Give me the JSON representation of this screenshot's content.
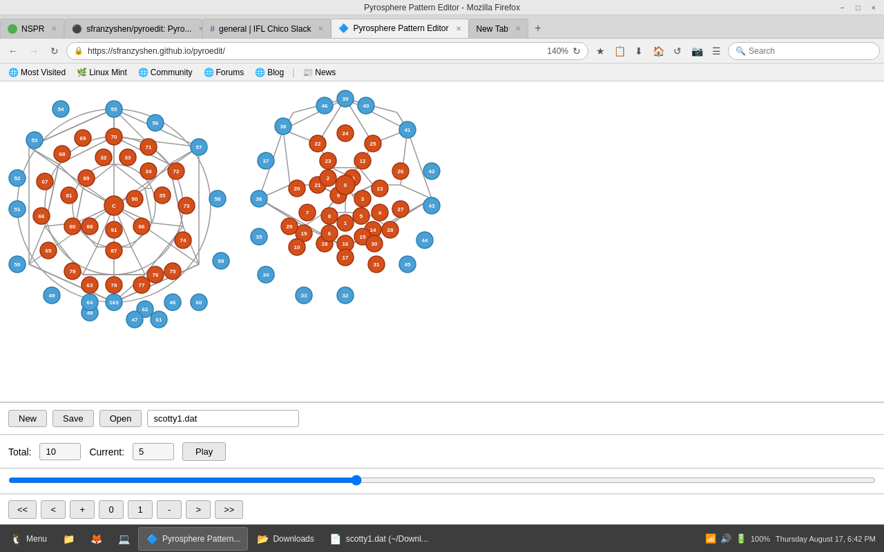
{
  "titlebar": {
    "title": "Pyrosphere Pattern Editor - Mozilla Firefox",
    "controls": [
      "−",
      "□",
      "×"
    ]
  },
  "tabs": [
    {
      "id": "nspr",
      "label": "NSPR",
      "icon_color": "#4CAF50",
      "active": false,
      "closable": true
    },
    {
      "id": "github",
      "label": "sfranzyshen/pyroedit: Pyro...",
      "icon_color": "#333",
      "active": false,
      "closable": true
    },
    {
      "id": "ifl",
      "label": "general | IFL Chico Slack",
      "icon_color": "#5a3e8a",
      "active": false,
      "closable": true
    },
    {
      "id": "pyrosphere",
      "label": "Pyrosphere Pattern Editor",
      "icon_color": "#e8612c",
      "active": true,
      "closable": true
    },
    {
      "id": "newtab",
      "label": "New Tab",
      "icon_color": "",
      "active": false,
      "closable": true
    }
  ],
  "navbar": {
    "back_disabled": false,
    "forward_disabled": true,
    "url": "https://sfranzyshen.github.io/pyroedit/",
    "zoom": "140%",
    "search_placeholder": "Search"
  },
  "bookmarks": [
    {
      "id": "most-visited",
      "label": "Most Visited",
      "icon": "🌐"
    },
    {
      "id": "linux-mint",
      "label": "Linux Mint",
      "icon": "🌿"
    },
    {
      "id": "community",
      "label": "Community",
      "icon": "🌐"
    },
    {
      "id": "forums",
      "label": "Forums",
      "icon": "🌐"
    },
    {
      "id": "blog",
      "label": "Blog",
      "icon": "🌐"
    },
    {
      "id": "news",
      "label": "News",
      "icon": "📰"
    }
  ],
  "toolbar": {
    "new_label": "New",
    "save_label": "Save",
    "open_label": "Open",
    "filename": "scotty1.dat"
  },
  "controls": {
    "total_label": "Total:",
    "total_value": "10",
    "current_label": "Current:",
    "current_value": "5",
    "play_label": "Play"
  },
  "nav_buttons": {
    "rewind": "<<",
    "prev": "<",
    "plus": "+",
    "zero": "0",
    "one": "1",
    "minus": "-",
    "next": ">",
    "fast_forward": ">>"
  },
  "taskbar": {
    "items": [
      {
        "id": "menu",
        "label": "Menu",
        "icon": "🐧"
      },
      {
        "id": "files",
        "label": "",
        "icon": "📁"
      },
      {
        "id": "browser",
        "label": "",
        "icon": "🦊"
      },
      {
        "id": "terminal",
        "label": "",
        "icon": "💻"
      },
      {
        "id": "pyrosphere",
        "label": "Pyrosphere Pattern...",
        "icon": "🔷",
        "active": true
      },
      {
        "id": "downloads",
        "label": "Downloads",
        "icon": "📂"
      },
      {
        "id": "scotty",
        "label": "scotty1.dat (~/Downl...",
        "icon": "📄"
      }
    ],
    "tray": {
      "network": "📶",
      "volume": "🔊",
      "battery": "🔋",
      "time": "Thursday August 17, 6:42 PM",
      "percentage": "100%"
    }
  }
}
